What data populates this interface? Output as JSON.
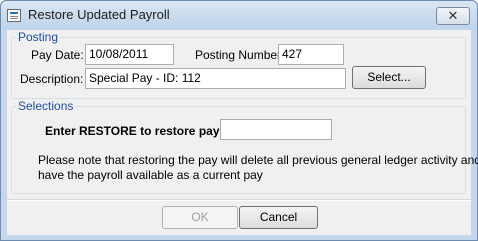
{
  "window": {
    "title": "Restore Updated Payroll",
    "close_glyph": "✕"
  },
  "posting": {
    "legend": "Posting",
    "pay_date_label": "Pay Date:",
    "pay_date_value": "10/08/2011",
    "posting_number_label": "Posting Number:",
    "posting_number_value": "427",
    "description_label": "Description:",
    "description_value": "Special Pay - ID: 112",
    "select_button": "Select..."
  },
  "selections": {
    "legend": "Selections",
    "restore_label": "Enter RESTORE to restore pay:",
    "restore_value": "",
    "note_line1": "Please note that restoring the pay will delete all previous general ledger activity and",
    "note_line2": "have the payroll available as a current pay"
  },
  "footer": {
    "ok_button": "OK",
    "cancel_button": "Cancel"
  },
  "colors": {
    "legend": "#1e4fa6",
    "frame": "#c5d7ec",
    "panel": "#f0f0f0"
  }
}
